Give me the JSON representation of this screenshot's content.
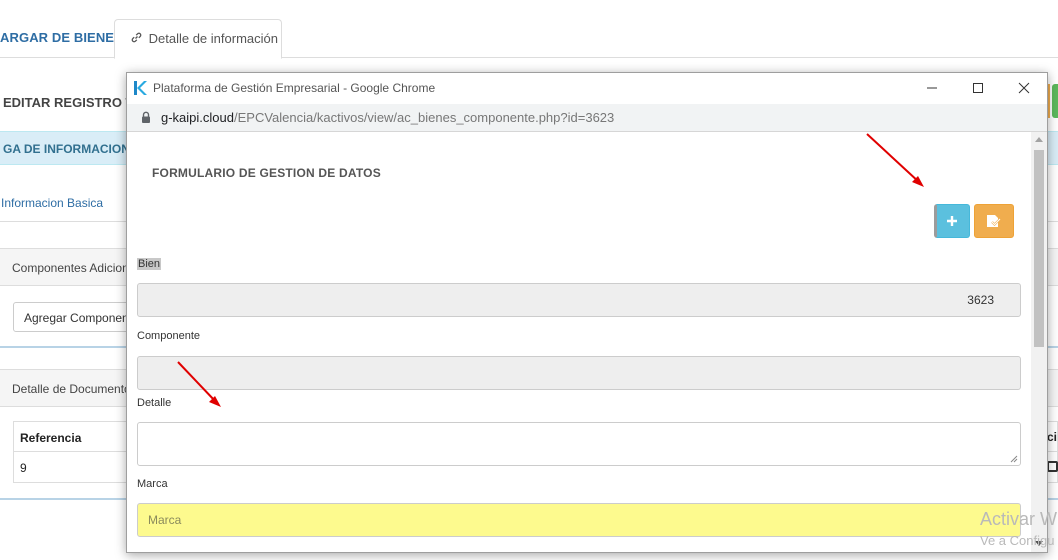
{
  "background": {
    "tab_cargar": "ARGAR DE BIENES",
    "tab_detalle": "Detalle de información",
    "heading": "EDITAR REGISTRO TI",
    "band": "GA DE INFORMACION D",
    "info_basica": "Informacion Basica",
    "panel_componentes": "Componentes Adicion",
    "agregar_button": "Agregar Componen",
    "panel_documentos": "Detalle de Documento",
    "table": {
      "header_referencia": "Referencia",
      "header_right": "ci",
      "row_referencia": "9"
    }
  },
  "window": {
    "title": "Plataforma de Gestión Empresarial - Google Chrome",
    "url_host": "g-kaipi.cloud",
    "url_path": "/EPCValencia/kactivos/view/ac_bienes_componente.php?id=3623"
  },
  "form": {
    "title": "FORMULARIO DE GESTION DE DATOS",
    "add_button": "add",
    "save_button": "save",
    "fields": {
      "bien_label": "Bien",
      "bien_value": "3623",
      "componente_label": "Componente",
      "componente_value": "",
      "detalle_label": "Detalle",
      "detalle_value": "",
      "marca_label": "Marca",
      "marca_placeholder": "Marca"
    }
  },
  "watermark": {
    "line1": "Activar W",
    "line2": "Ve a Configu"
  },
  "colors": {
    "info_button": "#5bc0de",
    "warning_button": "#f0ad4e",
    "highlight_field": "#fdfa8e",
    "annotation_arrow": "#e00000"
  }
}
